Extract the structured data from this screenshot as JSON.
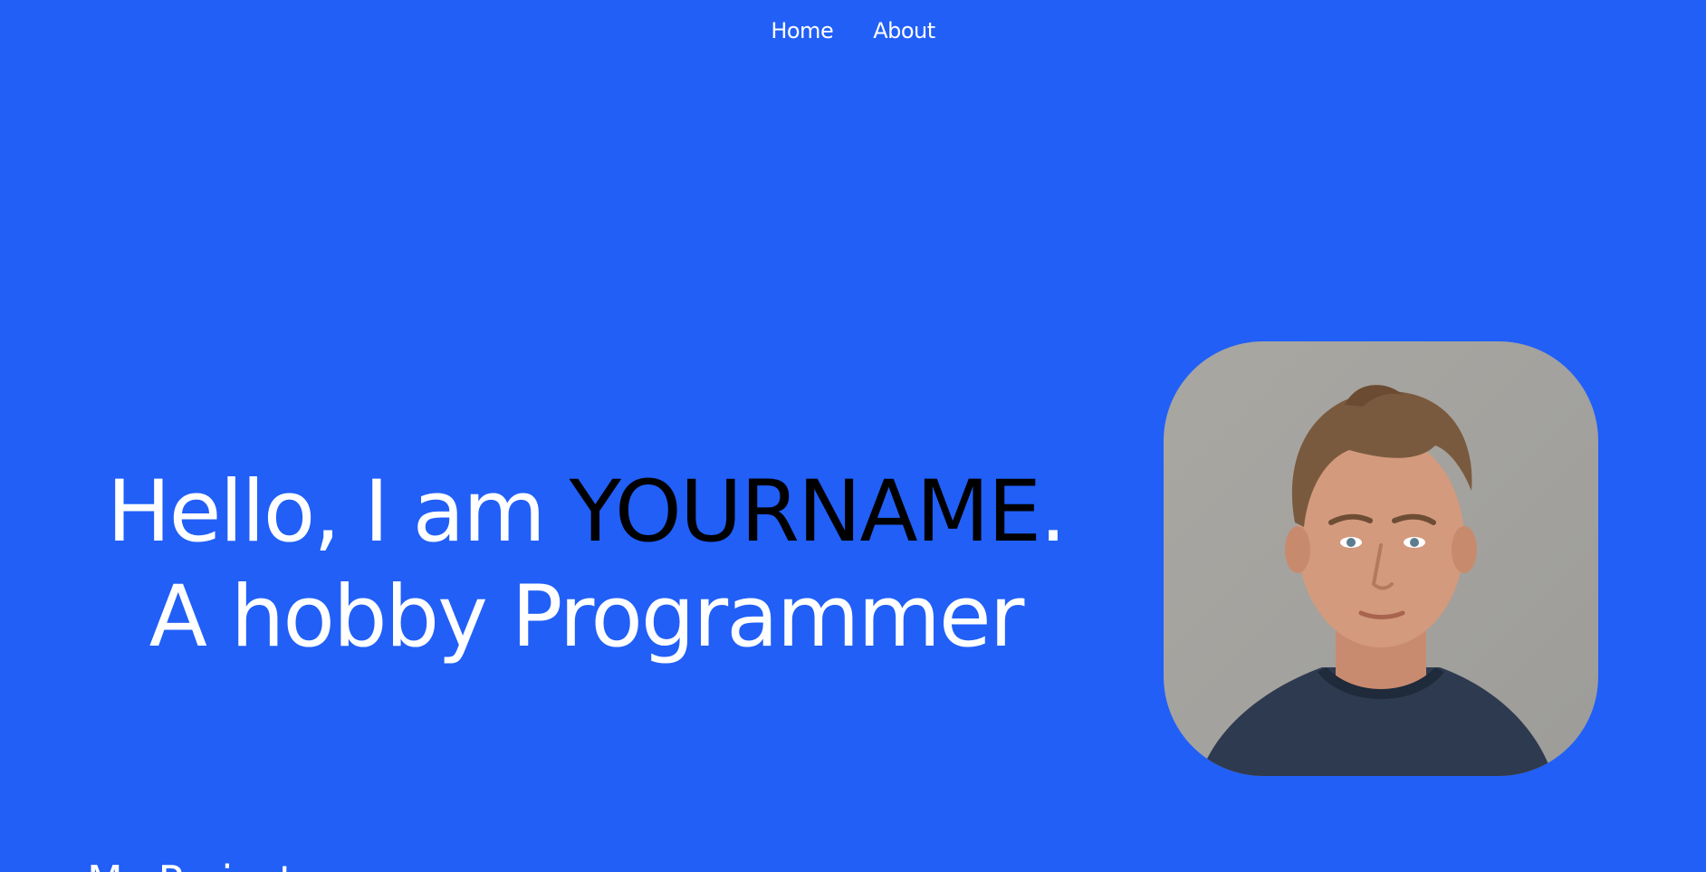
{
  "nav": {
    "home_label": "Home",
    "about_label": "About"
  },
  "hero": {
    "greeting": "Hello, I am ",
    "name": "YOURNAME",
    "name_suffix": ".",
    "tagline": "A hobby Programmer"
  },
  "section": {
    "heading": "My Projects"
  },
  "colors": {
    "background": "#215ff7",
    "text": "#ffffff",
    "name_highlight": "#000000"
  },
  "portrait": {
    "icon": "profile-photo"
  }
}
